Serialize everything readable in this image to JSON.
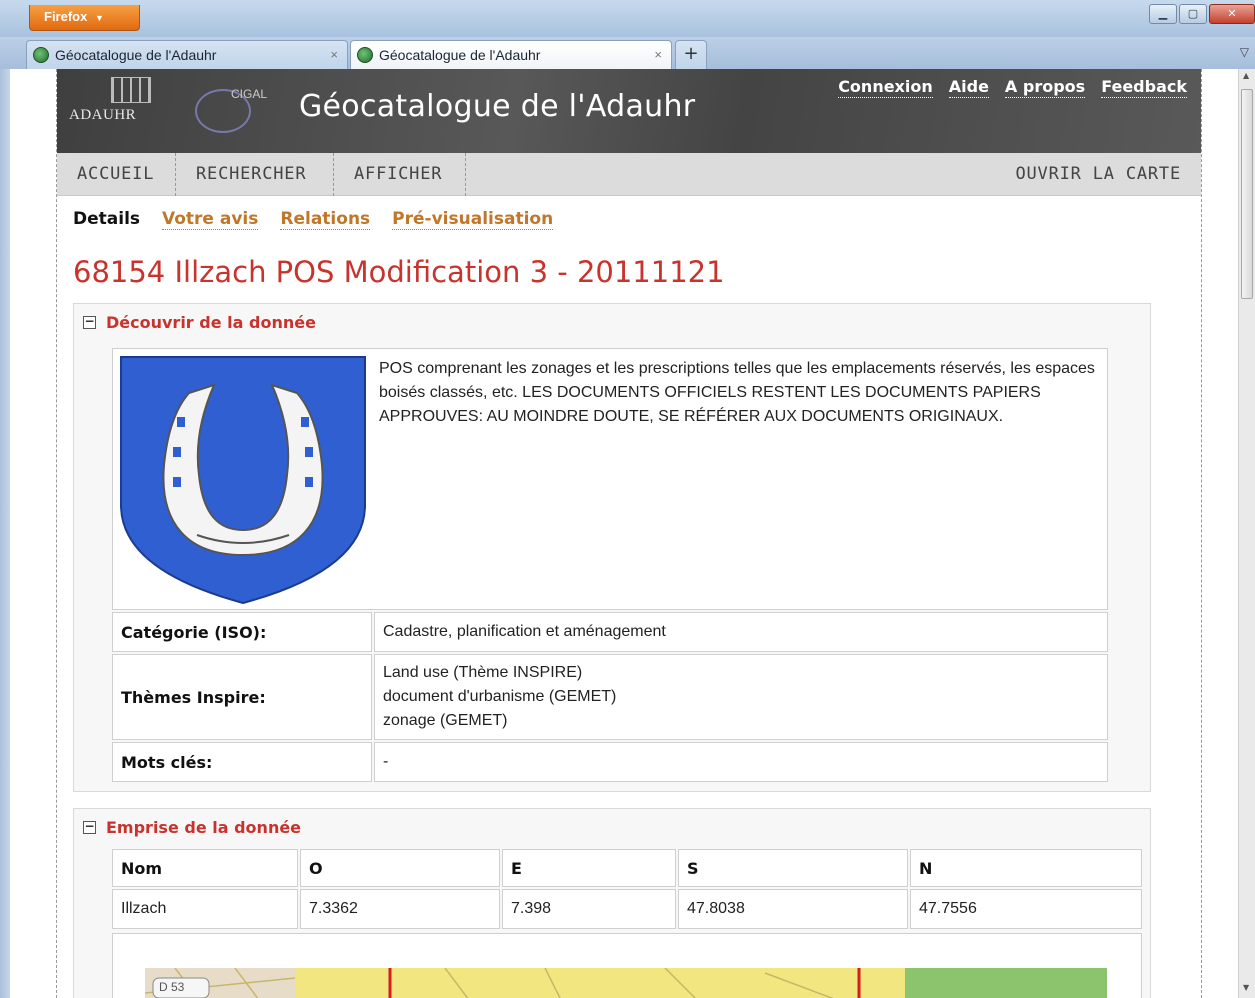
{
  "browser": {
    "app_button": "Firefox",
    "tabs": [
      {
        "title": "Géocatalogue de l'Adauhr"
      },
      {
        "title": "Géocatalogue de l'Adauhr"
      }
    ],
    "new_tab": "+",
    "close_glyph": "×"
  },
  "header": {
    "logo_adauhr": "ADAUHR",
    "logo_cigal": "CIGAL",
    "site_title": "Géocatalogue de l'Adauhr",
    "links": [
      "Connexion",
      "Aide",
      "A propos",
      "Feedback"
    ]
  },
  "nav": {
    "items": [
      "ACCUEIL",
      "RECHERCHER",
      "AFFICHER"
    ],
    "right": "OUVRIR LA CARTE"
  },
  "subtabs": {
    "active": "Details",
    "links": [
      "Votre avis",
      "Relations",
      "Pré-visualisation"
    ]
  },
  "record": {
    "title": "68154 Illzach POS Modification 3 - 20111121"
  },
  "discover": {
    "heading": "Découvrir de la donnée",
    "abstract": "POS comprenant les zonages et les prescriptions telles que les emplacements réservés, les espaces boisés classés, etc. LES DOCUMENTS OFFICIELS RESTENT LES DOCUMENTS PAPIERS APPROUVES: AU MOINDRE DOUTE, SE RÉFÉRER AUX DOCUMENTS ORIGINAUX.",
    "rows": [
      {
        "label": "Catégorie (ISO):",
        "values": [
          "Cadastre, planification et aménagement"
        ]
      },
      {
        "label": "Thèmes Inspire:",
        "values": [
          "Land use (Thème INSPIRE)",
          "document d'urbanisme (GEMET)",
          "zonage (GEMET)"
        ]
      },
      {
        "label": "Mots clés:",
        "values": [
          "-"
        ]
      }
    ]
  },
  "extent": {
    "heading": "Emprise de la donnée",
    "columns": [
      "Nom",
      "O",
      "E",
      "S",
      "N"
    ],
    "row": [
      "Illzach",
      "7.3362",
      "7.398",
      "47.8038",
      "47.7556"
    ],
    "map_label": "D 53"
  },
  "colors": {
    "accent_red": "#c8332d",
    "link_orange": "#c0772a",
    "shield_blue": "#2f5fd0"
  }
}
